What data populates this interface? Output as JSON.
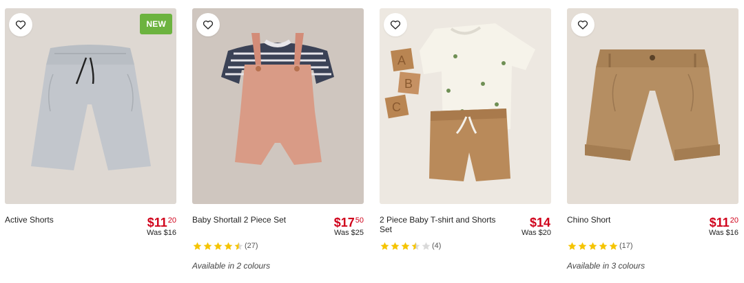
{
  "theme": {
    "price_color": "#d0021b",
    "badge_color": "#6cb33f",
    "star_color": "#f5c400",
    "star_empty": "#d9d9d9"
  },
  "products": [
    {
      "name": "Active Shorts",
      "price_dollars": "$11",
      "price_cents": "20",
      "was": "Was $16",
      "badge": "NEW",
      "rating": null,
      "review_count": null,
      "colours": null
    },
    {
      "name": "Baby Shortall 2 Piece Set",
      "price_dollars": "$17",
      "price_cents": "50",
      "was": "Was $25",
      "badge": null,
      "rating": 4.5,
      "review_count": "(27)",
      "colours": "Available in 2 colours"
    },
    {
      "name": "2 Piece Baby T-shirt and Shorts Set",
      "price_dollars": "$14",
      "price_cents": "",
      "was": "Was $20",
      "badge": null,
      "rating": 3.5,
      "review_count": "(4)",
      "colours": null
    },
    {
      "name": "Chino Short",
      "price_dollars": "$11",
      "price_cents": "20",
      "was": "Was $16",
      "badge": null,
      "rating": 5,
      "review_count": "(17)",
      "colours": "Available in 3 colours"
    }
  ]
}
